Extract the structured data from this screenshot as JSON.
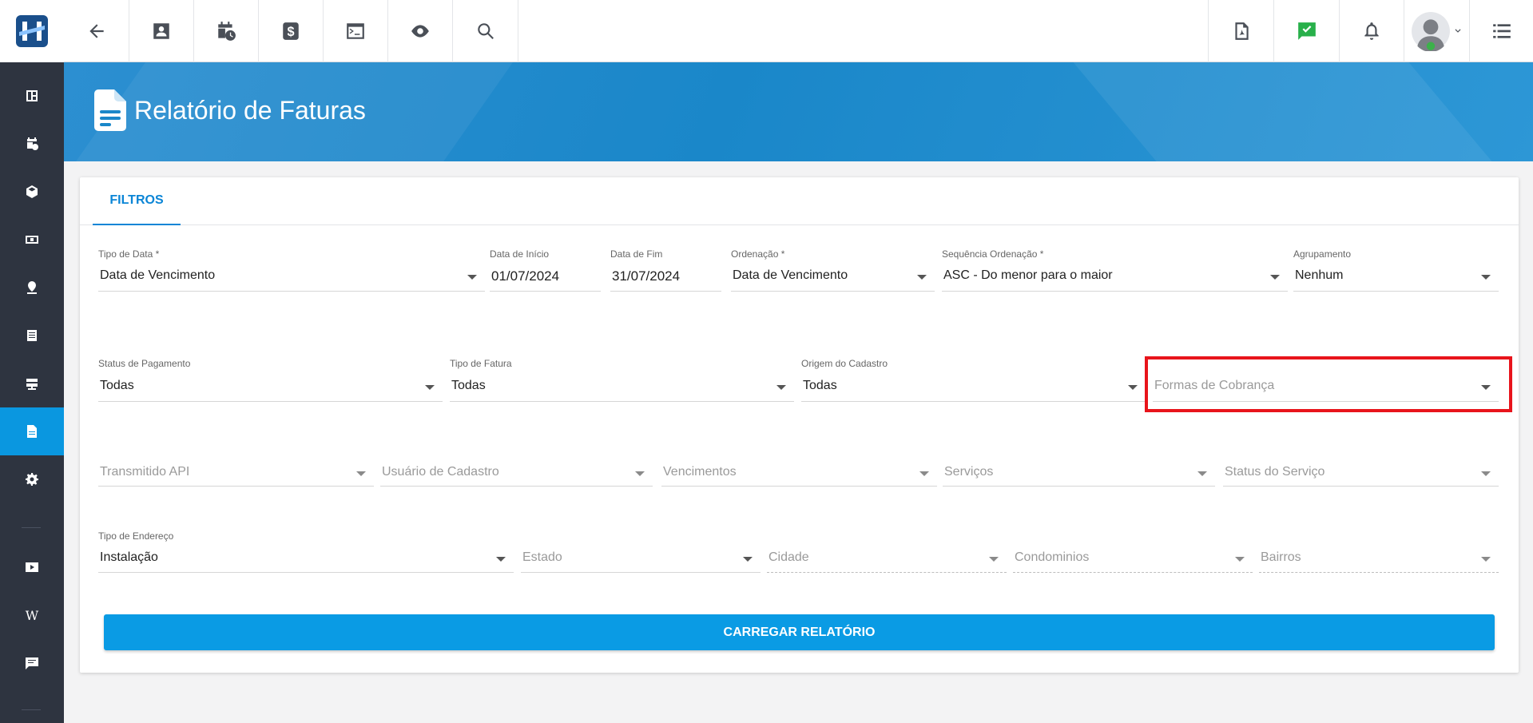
{
  "colors": {
    "accent": "#0a97e0",
    "sidebar_bg": "#2e3440",
    "banner": "#1a87c9",
    "highlight": "#e8141b"
  },
  "sidebar": {
    "items": [
      {
        "icon": "dashboard-icon"
      },
      {
        "icon": "calendar-clock-icon"
      },
      {
        "icon": "box-icon"
      },
      {
        "icon": "money-icon"
      },
      {
        "icon": "map-pin-icon"
      },
      {
        "icon": "list-icon"
      },
      {
        "icon": "server-icon"
      },
      {
        "icon": "document-icon",
        "active": true
      },
      {
        "icon": "gear-icon"
      },
      {
        "icon": "video-icon"
      },
      {
        "icon": "wiki-icon",
        "glyph": "W"
      },
      {
        "icon": "chat-icon"
      }
    ]
  },
  "topbar": {
    "left_icons": [
      "back-arrow-icon",
      "contact-card-icon",
      "calendar-clock-icon",
      "dollar-icon",
      "terminal-icon",
      "eye-icon",
      "search-icon"
    ],
    "right_icons": [
      "pdf-icon",
      "message-check-icon",
      "bell-icon",
      "avatar",
      "menu-list-icon"
    ]
  },
  "header": {
    "title": "Relatório de Faturas"
  },
  "tabs": [
    {
      "label": "FILTROS"
    }
  ],
  "filters": {
    "row1": [
      {
        "label": "Tipo de Data *",
        "value": "Data de Vencimento"
      },
      {
        "label": "Data de Início",
        "value": "01/07/2024"
      },
      {
        "label": "Data de Fim",
        "value": "31/07/2024"
      },
      {
        "label": "Ordenação *",
        "value": "Data de Vencimento"
      },
      {
        "label": "Sequência Ordenação *",
        "value": "ASC - Do menor para o maior"
      },
      {
        "label": "Agrupamento",
        "value": "Nenhum"
      }
    ],
    "row2": [
      {
        "label": "Status de Pagamento",
        "value": "Todas"
      },
      {
        "label": "Tipo de Fatura",
        "value": "Todas"
      },
      {
        "label": "Origem do Cadastro",
        "value": "Todas"
      },
      {
        "placeholder": "Formas de Cobrança"
      }
    ],
    "row3": [
      {
        "placeholder": "Transmitido API"
      },
      {
        "placeholder": "Usuário de Cadastro"
      },
      {
        "placeholder": "Vencimentos"
      },
      {
        "placeholder": "Serviços"
      },
      {
        "placeholder": "Status do Serviço"
      }
    ],
    "row4": [
      {
        "label": "Tipo de Endereço",
        "value": "Instalação"
      },
      {
        "placeholder": "Estado"
      },
      {
        "placeholder": "Cidade"
      },
      {
        "placeholder": "Condominios"
      },
      {
        "placeholder": "Bairros"
      }
    ]
  },
  "actions": {
    "load_label": "CARREGAR RELATÓRIO"
  }
}
